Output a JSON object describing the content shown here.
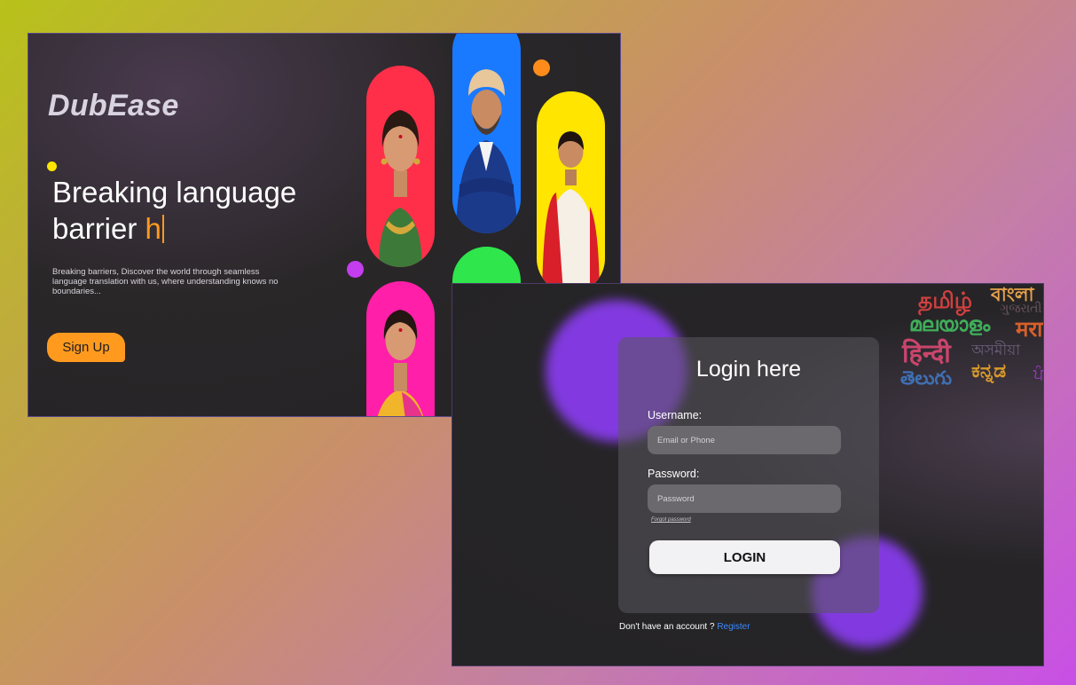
{
  "landing": {
    "brand": "DubEase",
    "headline_line1": "Breaking language",
    "headline_line2": "barrier ",
    "headline_typed": "h",
    "blurb": "Breaking barriers, Discover the world through seamless language translation with us, where understanding knows no boundaries...",
    "signup_label": "Sign Up",
    "portraits": [
      {
        "name": "portrait-woman-red",
        "bg": "#ff2f4a"
      },
      {
        "name": "portrait-man-blue-suit",
        "bg": "#1a7aff"
      },
      {
        "name": "portrait-woman-saree-yellow",
        "bg": "#ffe500"
      },
      {
        "name": "portrait-woman-pink",
        "bg": "#ff1fa8"
      },
      {
        "name": "portrait-man-white-green",
        "bg": "#2fe64d"
      },
      {
        "name": "portrait-bride-orange",
        "bg": "#ff9a2e"
      }
    ],
    "colors": {
      "accent": "#ff9a1f",
      "card_bg": "#232224"
    }
  },
  "login": {
    "title": "Login here",
    "username_label": "Username:",
    "username_placeholder": "Email or Phone",
    "password_label": "Password:",
    "password_placeholder": "Password",
    "forgot_label": "Forgot password",
    "login_label": "LOGIN",
    "register_prompt": "Don't have an account ? ",
    "register_link": "Register",
    "scripts": [
      {
        "text": "বাংলা",
        "color": "#e8a24a"
      },
      {
        "text": "தமிழ்",
        "color": "#d24040"
      },
      {
        "text": "ગુજરાતી",
        "color": "#6b5560"
      },
      {
        "text": "മലയാളം",
        "color": "#3fae5a"
      },
      {
        "text": "मराठी",
        "color": "#d8602a"
      },
      {
        "text": "हिन्दी",
        "color": "#c9456c"
      },
      {
        "text": "অসমীয়া",
        "color": "#6a5f7a"
      },
      {
        "text": "తెలుగు",
        "color": "#3f6fb2"
      },
      {
        "text": "ಕನ್ನಡ",
        "color": "#d89a2a"
      },
      {
        "text": "ਪੰ",
        "color": "#9a3ac0"
      }
    ],
    "colors": {
      "glow": "#8a3cf0",
      "link": "#3d8bff"
    }
  }
}
